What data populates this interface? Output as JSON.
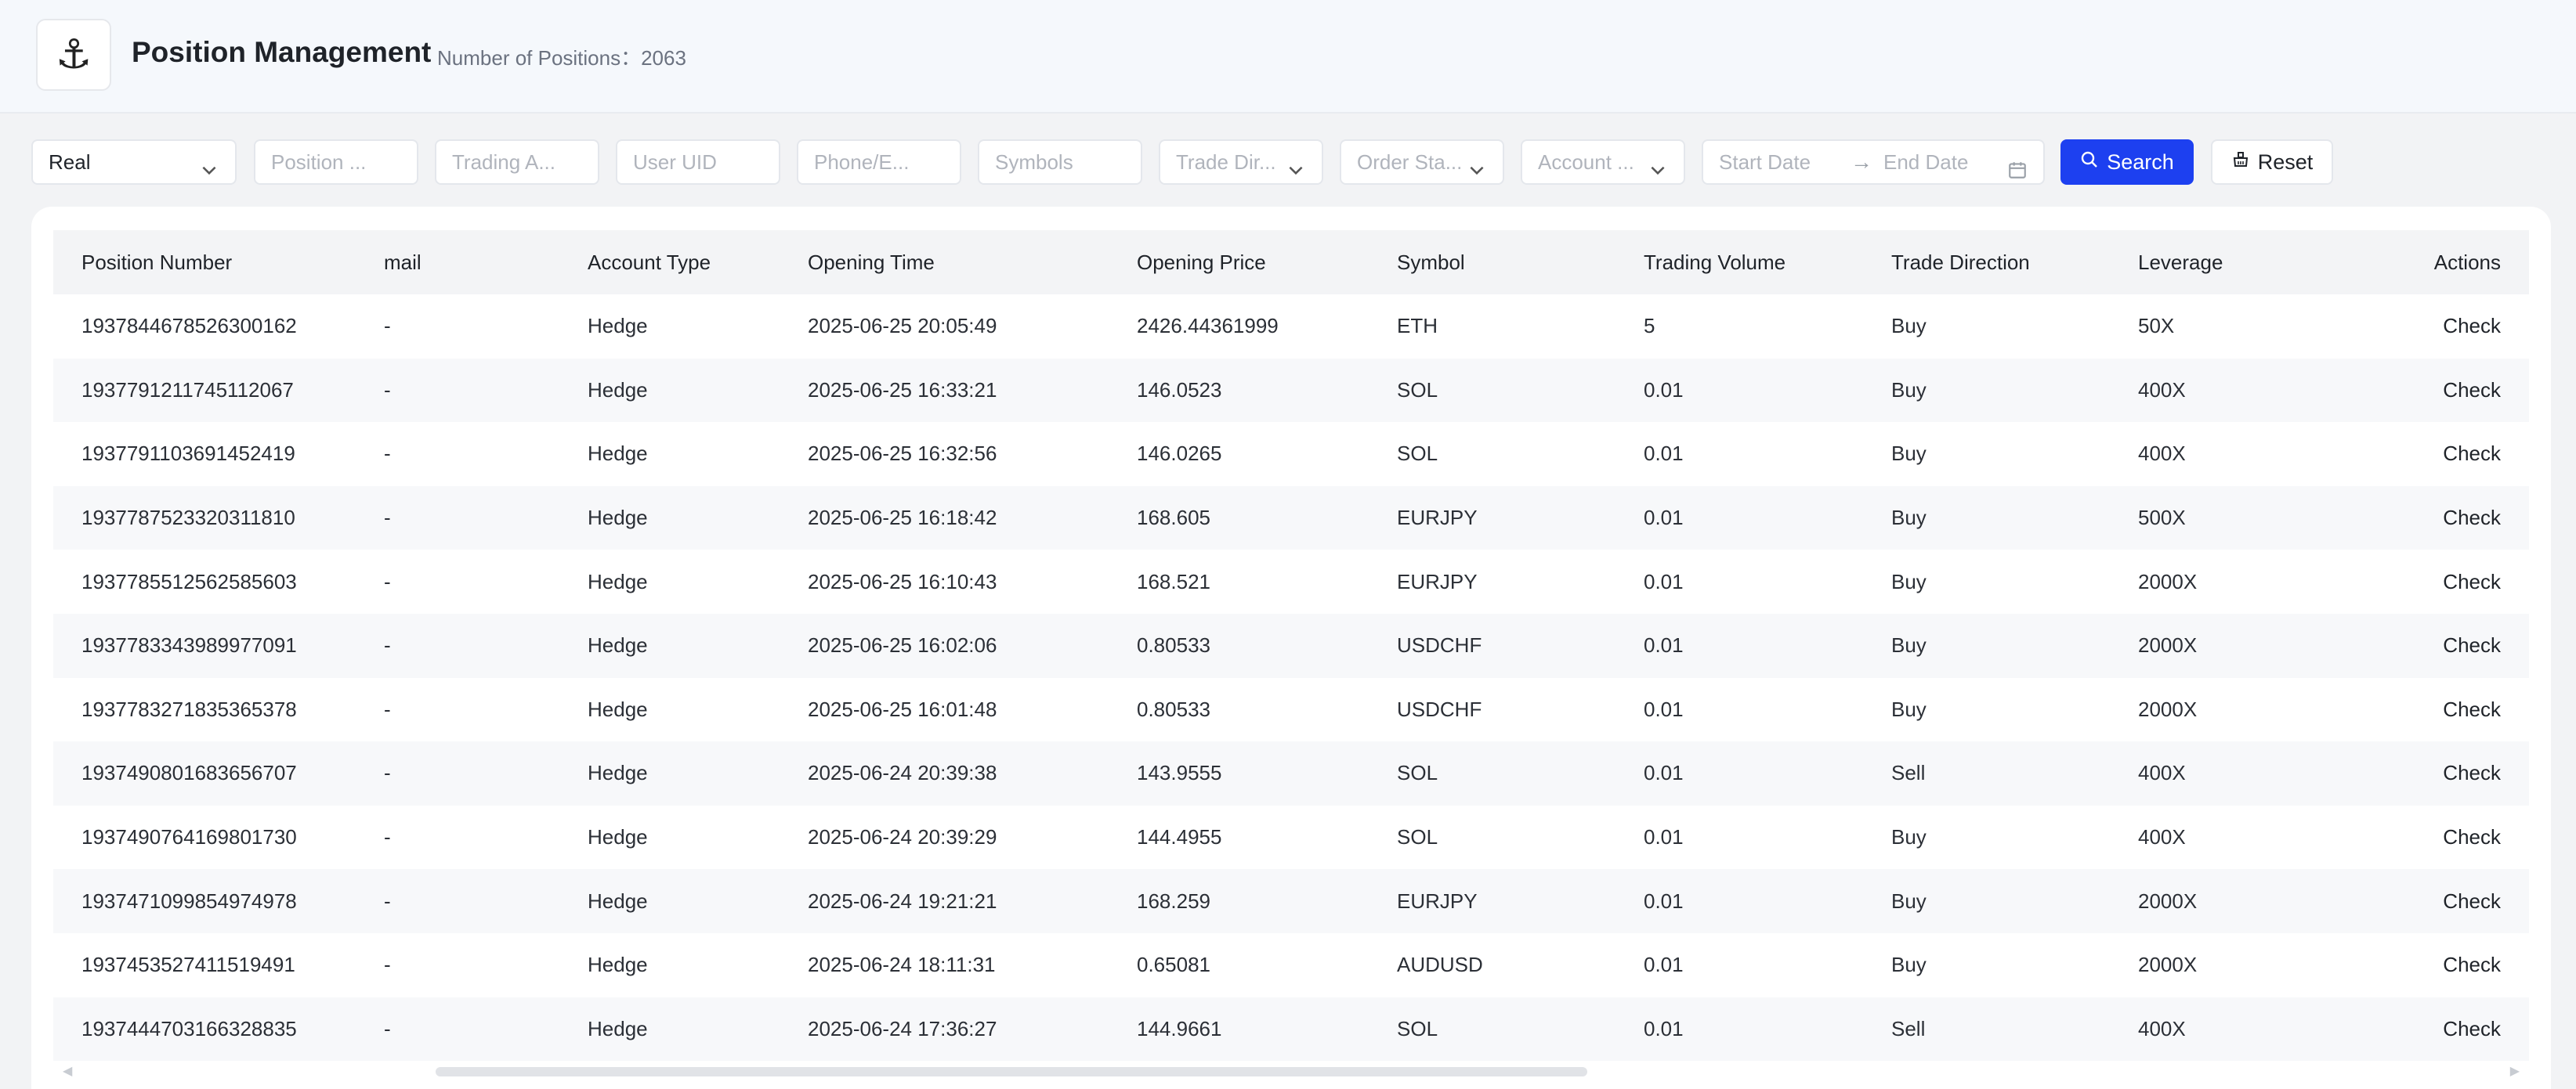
{
  "header": {
    "logo_icon": "anchor-icon",
    "title": "Position Management",
    "count_text": "Number of Positions：2063"
  },
  "filters": {
    "account_select": "Real",
    "position_placeholder": "Position ...",
    "trading_account_placeholder": "Trading A...",
    "user_uid_placeholder": "User UID",
    "phone_email_placeholder": "Phone/E...",
    "symbols_placeholder": "Symbols",
    "trade_direction_placeholder": "Trade Dir...",
    "order_status_placeholder": "Order Sta...",
    "account_type_placeholder": "Account ...",
    "start_date_placeholder": "Start Date",
    "end_date_placeholder": "End Date",
    "search_label": "Search",
    "reset_label": "Reset"
  },
  "table": {
    "columns": {
      "position_number": "Position Number",
      "email": "mail",
      "account_type": "Account Type",
      "opening_time": "Opening Time",
      "opening_price": "Opening Price",
      "symbol": "Symbol",
      "trading_volume": "Trading Volume",
      "trade_direction": "Trade Direction",
      "leverage": "Leverage",
      "actions": "Actions"
    },
    "rows": [
      {
        "pos": "1937844678526300162",
        "email": "-",
        "acct": "Hedge",
        "time": "2025-06-25 20:05:49",
        "price": "2426.44361999",
        "sym": "ETH",
        "vol": "5",
        "dir": "Buy",
        "lev": "50X",
        "action": "Check"
      },
      {
        "pos": "1937791211745112067",
        "email": "-",
        "acct": "Hedge",
        "time": "2025-06-25 16:33:21",
        "price": "146.0523",
        "sym": "SOL",
        "vol": "0.01",
        "dir": "Buy",
        "lev": "400X",
        "action": "Check"
      },
      {
        "pos": "1937791103691452419",
        "email": "-",
        "acct": "Hedge",
        "time": "2025-06-25 16:32:56",
        "price": "146.0265",
        "sym": "SOL",
        "vol": "0.01",
        "dir": "Buy",
        "lev": "400X",
        "action": "Check"
      },
      {
        "pos": "1937787523320311810",
        "email": "-",
        "acct": "Hedge",
        "time": "2025-06-25 16:18:42",
        "price": "168.605",
        "sym": "EURJPY",
        "vol": "0.01",
        "dir": "Buy",
        "lev": "500X",
        "action": "Check"
      },
      {
        "pos": "1937785512562585603",
        "email": "-",
        "acct": "Hedge",
        "time": "2025-06-25 16:10:43",
        "price": "168.521",
        "sym": "EURJPY",
        "vol": "0.01",
        "dir": "Buy",
        "lev": "2000X",
        "action": "Check"
      },
      {
        "pos": "1937783343989977091",
        "email": "-",
        "acct": "Hedge",
        "time": "2025-06-25 16:02:06",
        "price": "0.80533",
        "sym": "USDCHF",
        "vol": "0.01",
        "dir": "Buy",
        "lev": "2000X",
        "action": "Check"
      },
      {
        "pos": "1937783271835365378",
        "email": "-",
        "acct": "Hedge",
        "time": "2025-06-25 16:01:48",
        "price": "0.80533",
        "sym": "USDCHF",
        "vol": "0.01",
        "dir": "Buy",
        "lev": "2000X",
        "action": "Check"
      },
      {
        "pos": "1937490801683656707",
        "email": "-",
        "acct": "Hedge",
        "time": "2025-06-24 20:39:38",
        "price": "143.9555",
        "sym": "SOL",
        "vol": "0.01",
        "dir": "Sell",
        "lev": "400X",
        "action": "Check"
      },
      {
        "pos": "1937490764169801730",
        "email": "-",
        "acct": "Hedge",
        "time": "2025-06-24 20:39:29",
        "price": "144.4955",
        "sym": "SOL",
        "vol": "0.01",
        "dir": "Buy",
        "lev": "400X",
        "action": "Check"
      },
      {
        "pos": "1937471099854974978",
        "email": "-",
        "acct": "Hedge",
        "time": "2025-06-24 19:21:21",
        "price": "168.259",
        "sym": "EURJPY",
        "vol": "0.01",
        "dir": "Buy",
        "lev": "2000X",
        "action": "Check"
      },
      {
        "pos": "1937453527411519491",
        "email": "-",
        "acct": "Hedge",
        "time": "2025-06-24 18:11:31",
        "price": "0.65081",
        "sym": "AUDUSD",
        "vol": "0.01",
        "dir": "Buy",
        "lev": "2000X",
        "action": "Check"
      },
      {
        "pos": "1937444703166328835",
        "email": "-",
        "acct": "Hedge",
        "time": "2025-06-24 17:36:27",
        "price": "144.9661",
        "sym": "SOL",
        "vol": "0.01",
        "dir": "Sell",
        "lev": "400X",
        "action": "Check"
      }
    ]
  },
  "colors": {
    "primary": "#1d40f0",
    "header_bg": "#f5f8fc",
    "row_stripe": "#f7f8fa"
  }
}
